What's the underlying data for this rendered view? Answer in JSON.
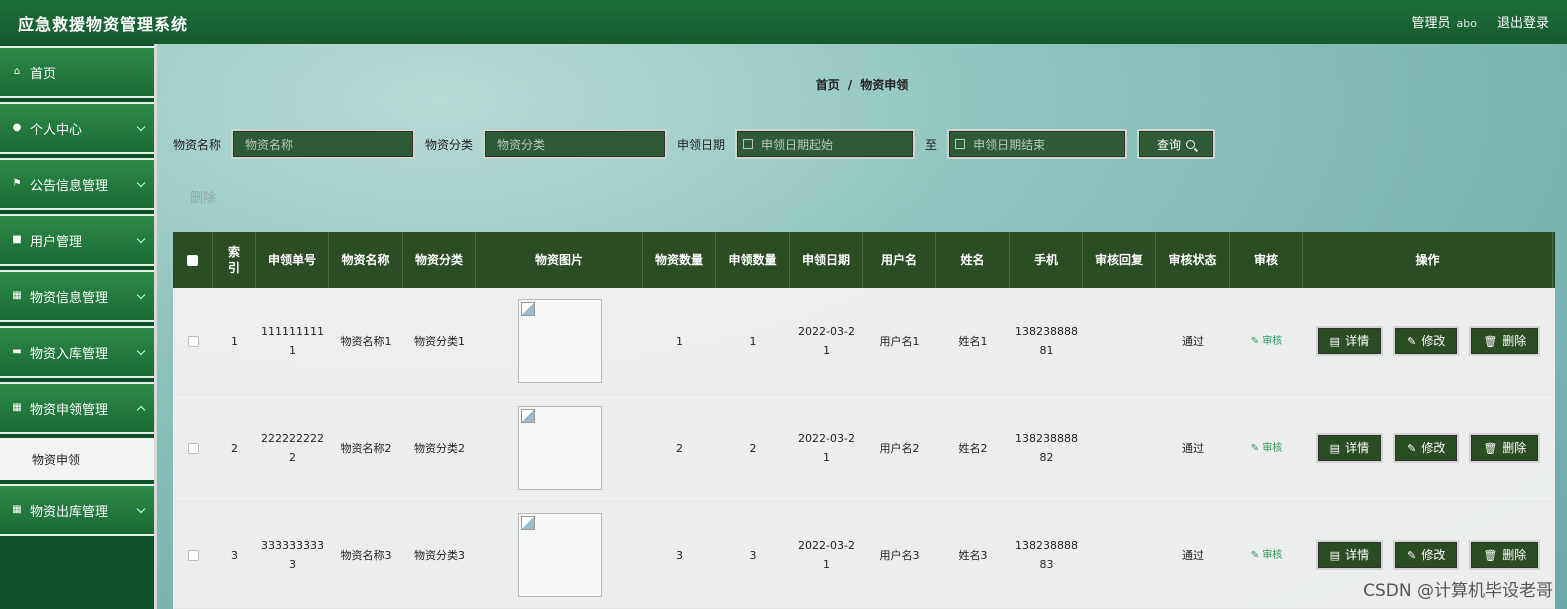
{
  "header": {
    "title": "应急救援物资管理系统",
    "role": "管理员",
    "user": "abo",
    "logout": "退出登录"
  },
  "sidebar": {
    "items": [
      {
        "label": "首页",
        "icon": "home-icon"
      },
      {
        "label": "个人中心",
        "icon": "person-icon"
      },
      {
        "label": "公告信息管理",
        "icon": "flag-icon"
      },
      {
        "label": "用户管理",
        "icon": "square-icon"
      },
      {
        "label": "物资信息管理",
        "icon": "grid-icon"
      },
      {
        "label": "物资入库管理",
        "icon": "chat-icon"
      },
      {
        "label": "物资申领管理",
        "icon": "grid-icon"
      }
    ],
    "active_sub": "物资申领",
    "last_item": {
      "label": "物资出库管理",
      "icon": "grid-icon"
    }
  },
  "breadcrumb": {
    "home": "首页",
    "sep": "/",
    "current": "物资申领"
  },
  "search": {
    "name_label": "物资名称",
    "name_placeholder": "物资名称",
    "cat_label": "物资分类",
    "cat_placeholder": "物资分类",
    "date_label": "申领日期",
    "date_start_placeholder": "申领日期起始",
    "to": "至",
    "date_end_placeholder": "申领日期结束",
    "query_button": "查询"
  },
  "bulk_delete": "删除",
  "table": {
    "headers": [
      "索引",
      "申领单号",
      "物资名称",
      "物资分类",
      "物资图片",
      "物资数量",
      "申领数量",
      "申领日期",
      "用户名",
      "姓名",
      "手机",
      "审核回复",
      "审核状态",
      "审核",
      "操作"
    ],
    "header_index_line1": "索",
    "header_index_line2": "引",
    "rows": [
      {
        "index": "1",
        "order_l1": "111111111",
        "order_l2": "1",
        "name": "物资名称1",
        "category": "物资分类1",
        "qty": "1",
        "req_qty": "1",
        "date_l1": "2022-03-2",
        "date_l2": "1",
        "username": "用户名1",
        "realname": "姓名1",
        "phone_l1": "138238888",
        "phone_l2": "81",
        "reply": "",
        "status": "通过",
        "audit": "审核"
      },
      {
        "index": "2",
        "order_l1": "222222222",
        "order_l2": "2",
        "name": "物资名称2",
        "category": "物资分类2",
        "qty": "2",
        "req_qty": "2",
        "date_l1": "2022-03-2",
        "date_l2": "1",
        "username": "用户名2",
        "realname": "姓名2",
        "phone_l1": "138238888",
        "phone_l2": "82",
        "reply": "",
        "status": "通过",
        "audit": "审核"
      },
      {
        "index": "3",
        "order_l1": "333333333",
        "order_l2": "3",
        "name": "物资名称3",
        "category": "物资分类3",
        "qty": "3",
        "req_qty": "3",
        "date_l1": "2022-03-2",
        "date_l2": "1",
        "username": "用户名3",
        "realname": "姓名3",
        "phone_l1": "138238888",
        "phone_l2": "83",
        "reply": "",
        "status": "通过",
        "audit": "审核"
      }
    ],
    "actions": {
      "detail": "详情",
      "edit": "修改",
      "delete": "删除"
    }
  },
  "watermark": "CSDN @计算机毕设老哥"
}
